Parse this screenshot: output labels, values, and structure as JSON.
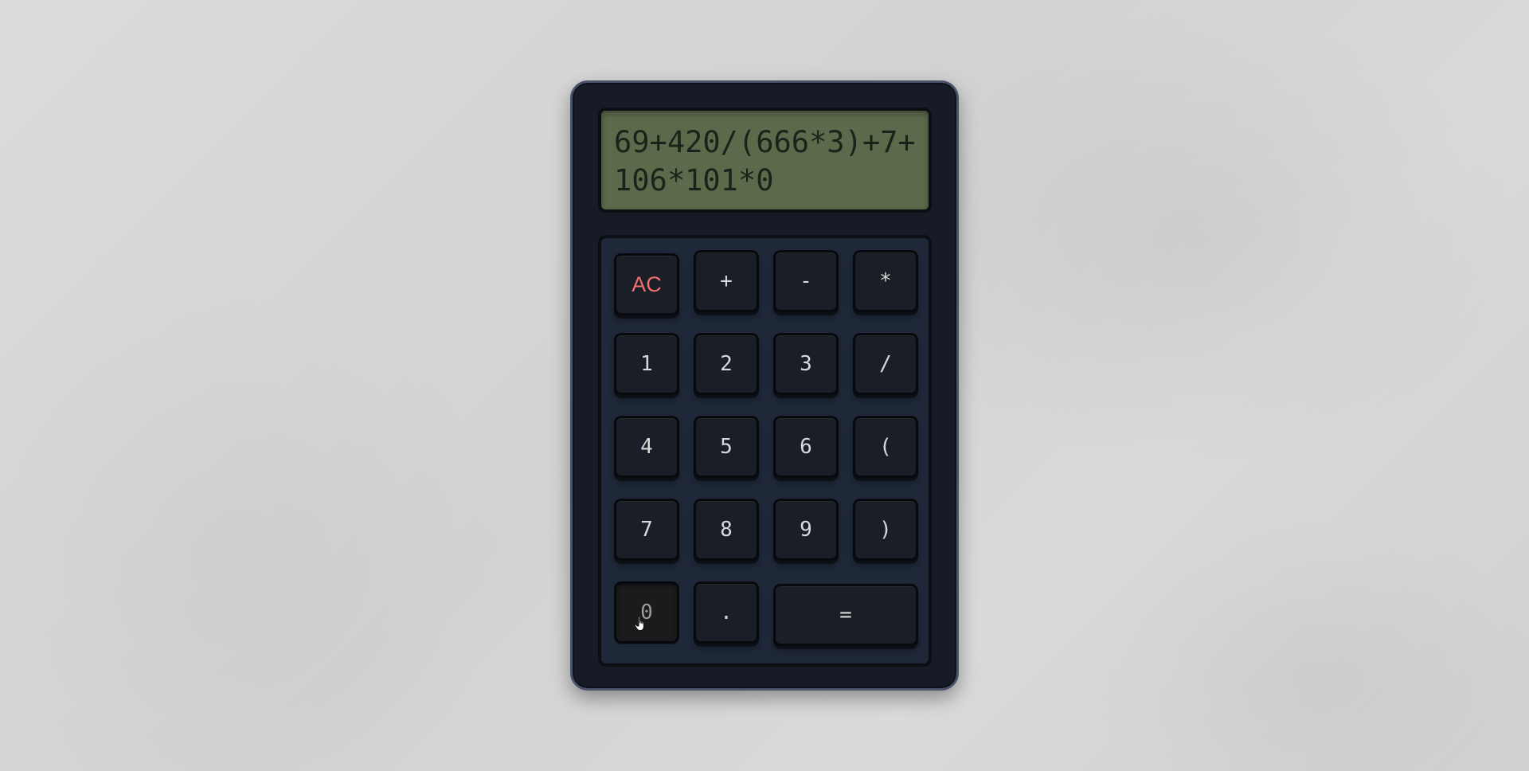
{
  "display": {
    "expression": "69+420/(666*3)+7+106*101*0"
  },
  "keys": {
    "ac": "AC",
    "plus": "+",
    "minus": "-",
    "multiply": "*",
    "one": "1",
    "two": "2",
    "three": "3",
    "divide": "/",
    "four": "4",
    "five": "5",
    "six": "6",
    "open_paren": "(",
    "seven": "7",
    "eight": "8",
    "nine": "9",
    "close_paren": ")",
    "zero": "0",
    "decimal": ".",
    "equals": "="
  },
  "colors": {
    "display_bg": "#5c6a4c",
    "display_text": "#1c2219",
    "body": "#161b25",
    "keypad_bg": "#1f2839",
    "key_bg": "#1a1e26",
    "ac_text": "#f07070"
  },
  "icons": {
    "pointer": "hand-pointer-icon"
  }
}
